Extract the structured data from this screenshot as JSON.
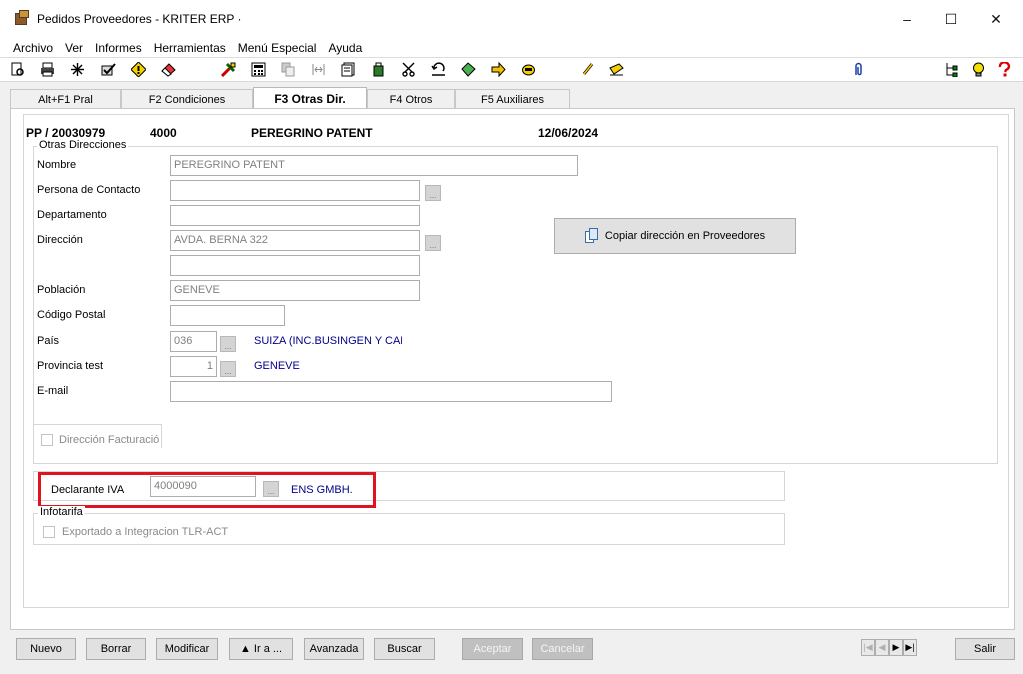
{
  "window": {
    "title": "Pedidos Proveedores - KRITER ERP ·",
    "minimize": "–",
    "maximize": "☐",
    "close": "✕"
  },
  "menu": [
    "Archivo",
    "Ver",
    "Informes",
    "Herramientas",
    "Menú Especial",
    "Ayuda"
  ],
  "toolbar_icons": [
    "preview-icon",
    "print-icon",
    "star-icon",
    "check-icon",
    "warning-icon",
    "eraser-icon",
    "tools-icon",
    "calculator-icon",
    "copy-icon",
    "split-icon",
    "document-icon",
    "bottle-icon",
    "scissors-icon",
    "undo-icon",
    "gem-icon",
    "arrow-icon",
    "bell-icon",
    "clip-icon",
    "pen-icon",
    "paperclip-icon",
    "tree-icon",
    "bulb-icon",
    "help-icon"
  ],
  "tabs": [
    "Alt+F1 Pral",
    "F2 Condiciones",
    "F3 Otras Dir.",
    "F4 Otros",
    "F5 Auxiliares"
  ],
  "header": {
    "code": "PP / 20030979",
    "num": "4000",
    "name": "PEREGRINO PATENT",
    "date": "12/06/2024"
  },
  "otras_direcciones": {
    "group_label": "Otras Direcciones",
    "nombre_label": "Nombre",
    "nombre_value": "PEREGRINO PATENT",
    "contacto_label": "Persona de Contacto",
    "contacto_value": "",
    "departamento_label": "Departamento",
    "departamento_value": "",
    "direccion_label": "Dirección",
    "direccion_value": "AVDA. BERNA 322",
    "direccion2_value": "",
    "poblacion_label": "Población",
    "poblacion_value": "GENEVE",
    "cp_label": "Código Postal",
    "cp_value": "",
    "pais_label": "País",
    "pais_value": "036",
    "pais_name": "SUIZA (INC.BUSINGEN Y CAN",
    "provincia_label": "Provincia test",
    "provincia_value": "1",
    "provincia_name": "GENEVE",
    "email_label": "E-mail",
    "email_value": "",
    "facturacion_label": "Dirección Facturació",
    "copy_button": "Copiar dirección en Proveedores",
    "ellipsis": "..."
  },
  "declarante": {
    "label": "Declarante IVA",
    "value": "4000090",
    "name": "ENS GMBH."
  },
  "infotarifa": {
    "group_label": "Infotarifa",
    "exportado_label": "Exportado a Integracion TLR-ACT"
  },
  "buttons": {
    "nuevo": "Nuevo",
    "borrar": "Borrar",
    "modificar": "Modificar",
    "ira": "▲  Ir a ...",
    "avanzada": "Avanzada",
    "buscar": "Buscar",
    "aceptar": "Aceptar",
    "cancelar": "Cancelar",
    "salir": "Salir"
  },
  "nav": {
    "first": "|◀",
    "prev": "◀",
    "next": "▶",
    "last": "▶|"
  }
}
